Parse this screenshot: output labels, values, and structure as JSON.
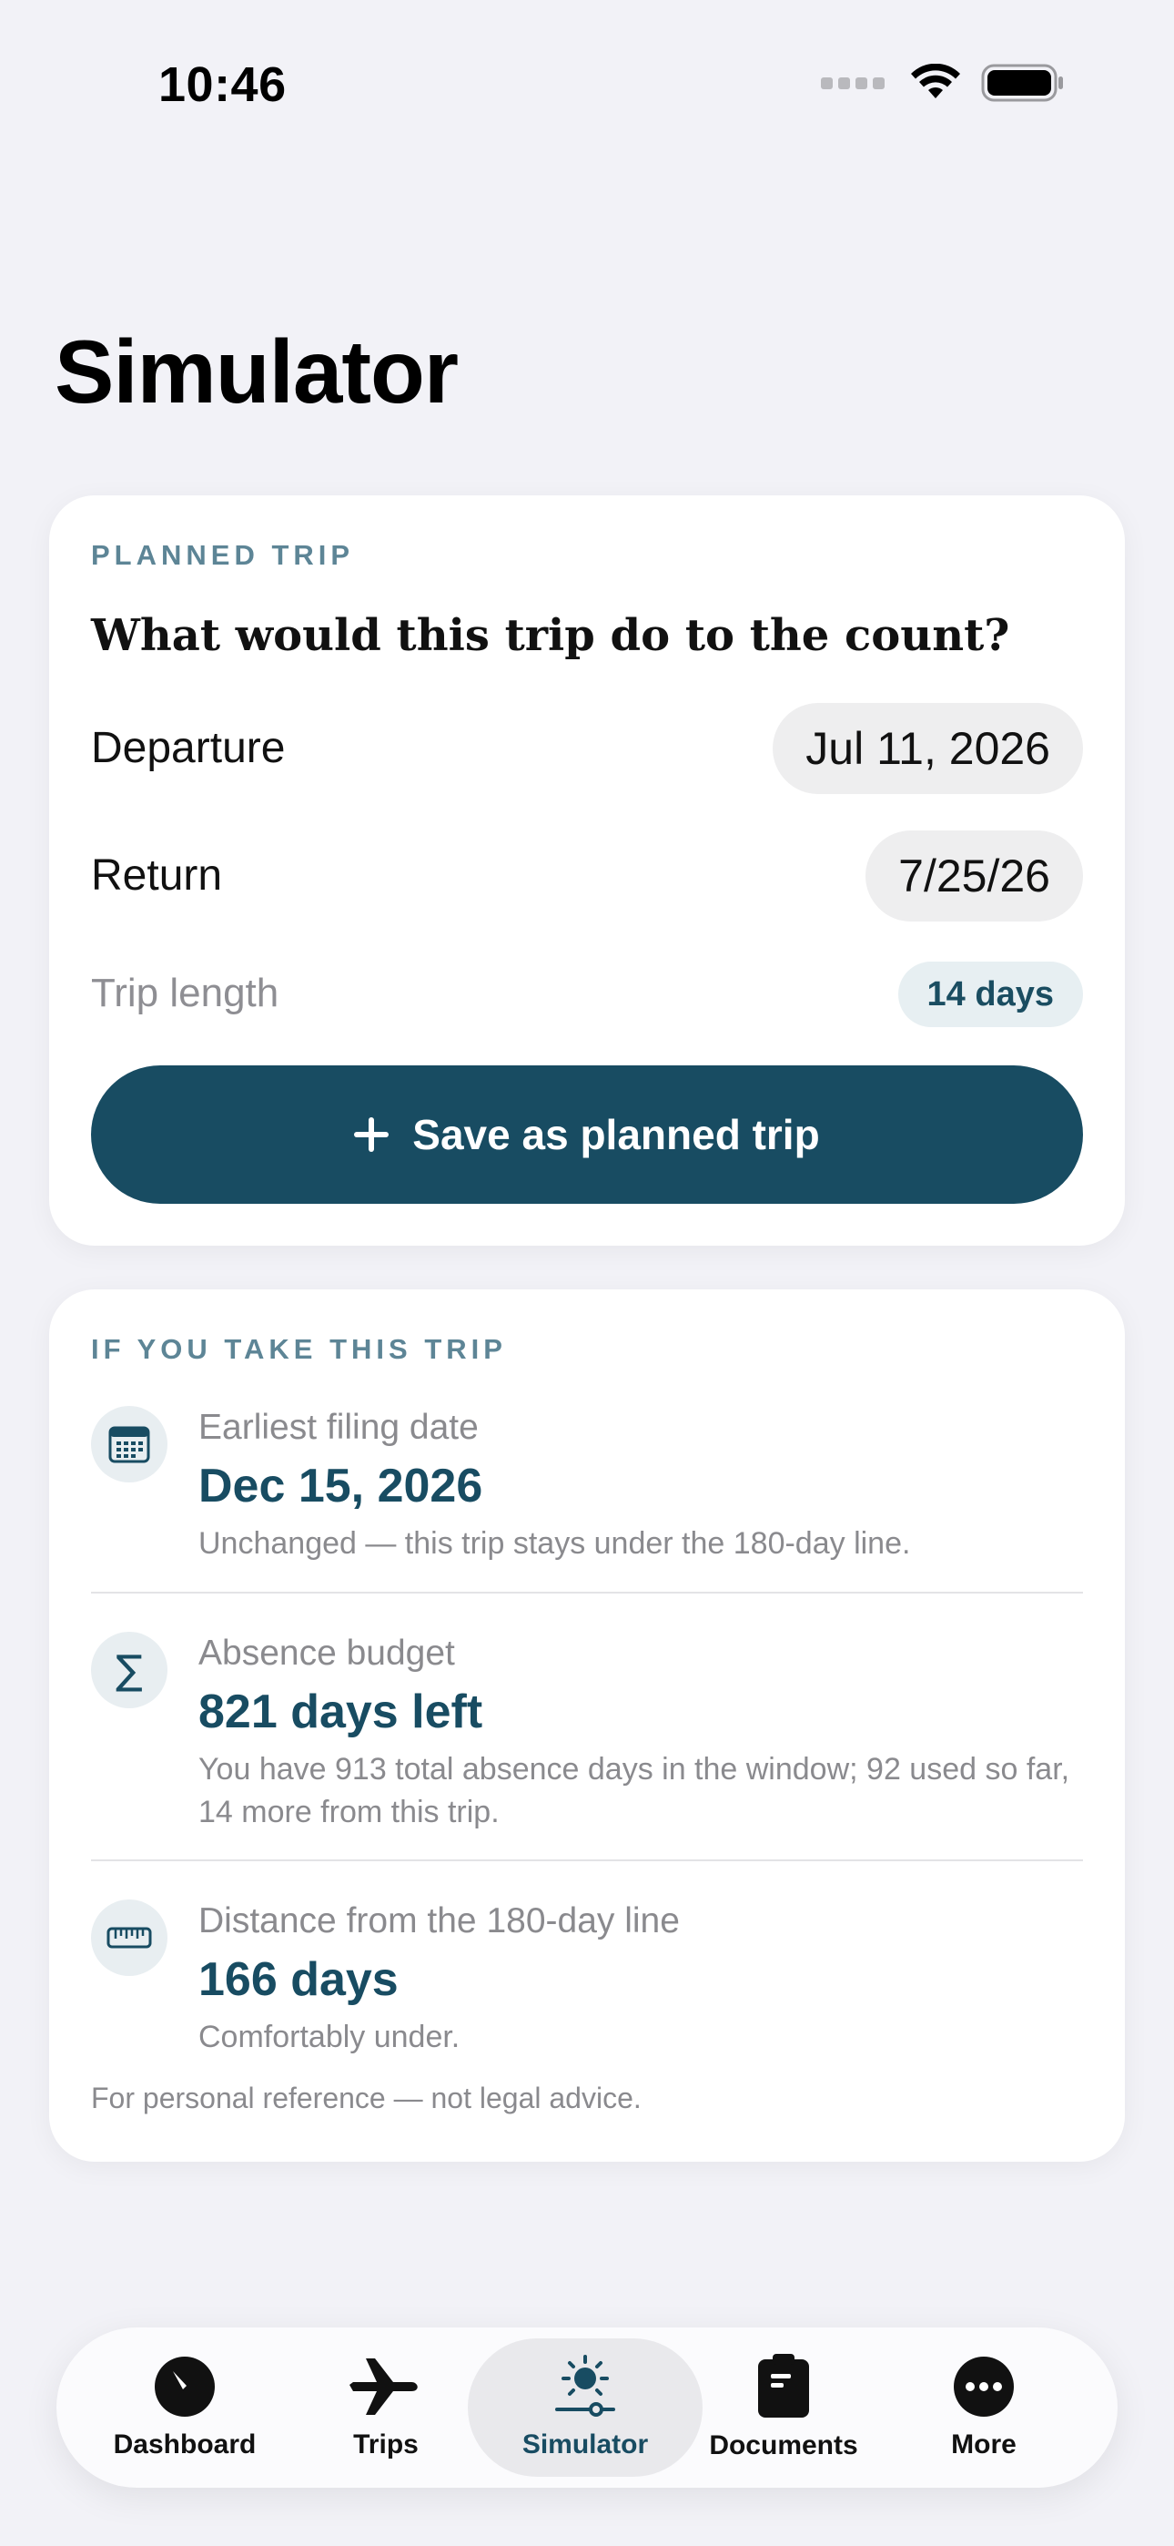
{
  "status_bar": {
    "time": "10:46"
  },
  "page": {
    "title": "Simulator"
  },
  "planned_trip": {
    "eyebrow": "PLANNED TRIP",
    "heading": "What would this trip do to the count?",
    "departure_label": "Departure",
    "departure_value": "Jul 11, 2026",
    "return_label": "Return",
    "return_value": "7/25/26",
    "length_label": "Trip length",
    "length_value": "14 days",
    "save_button": "Save as planned trip"
  },
  "impact": {
    "eyebrow": "IF YOU TAKE THIS TRIP",
    "metrics": [
      {
        "icon": "calendar-icon",
        "label": "Earliest filing date",
        "value": "Dec 15, 2026",
        "note": "Unchanged — this trip stays under the 180-day line."
      },
      {
        "icon": "sigma-icon",
        "label": "Absence budget",
        "value": "821 days left",
        "note": "You have 913 total absence days in the window; 92 used so far, 14 more from this trip."
      },
      {
        "icon": "ruler-icon",
        "label": "Distance from the 180-day line",
        "value": "166 days",
        "note": "Comfortably under."
      }
    ],
    "footnote": "For personal reference — not legal advice."
  },
  "tab_bar": {
    "tabs": [
      {
        "label": "Dashboard",
        "icon": "gauge-icon"
      },
      {
        "label": "Trips",
        "icon": "airplane-icon"
      },
      {
        "label": "Simulator",
        "icon": "sun-slider-icon",
        "active": true
      },
      {
        "label": "Documents",
        "icon": "clipboard-icon"
      },
      {
        "label": "More",
        "icon": "ellipsis-icon"
      }
    ]
  },
  "colors": {
    "accent": "#184c62",
    "eyebrow": "#5d8596",
    "background": "#f2f2f7"
  }
}
